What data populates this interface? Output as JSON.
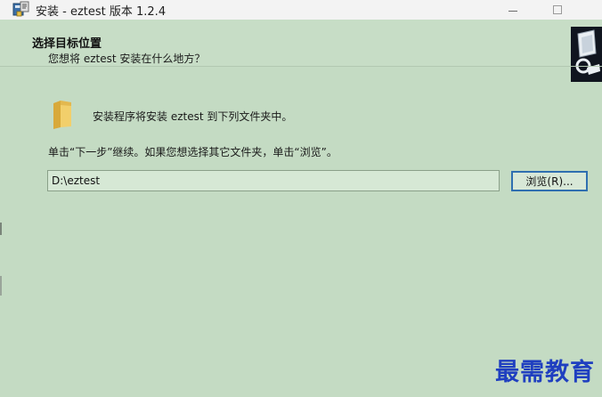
{
  "window": {
    "title": "安装 - eztest 版本 1.2.4",
    "icon": "installer-icon"
  },
  "header": {
    "title": "选择目标位置",
    "subtitle": "您想将 eztest 安装在什么地方？"
  },
  "content": {
    "info_text": "安装程序将安装 eztest 到下列文件夹中。",
    "instruction": "单击“下一步”继续。如果您想选择其它文件夹，单击“浏览”。",
    "path_value": "D:\\eztest",
    "browse_label": "浏览(R)..."
  },
  "watermark": "最需教育",
  "colors": {
    "background": "#c4dbc3",
    "button_focus_border": "#2f6fb0",
    "watermark": "#1f3fc0"
  }
}
